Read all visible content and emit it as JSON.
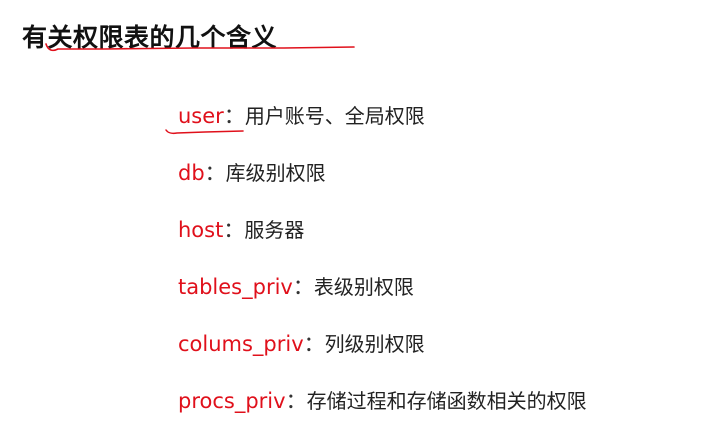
{
  "title": "有关权限表的几个含义",
  "separator": "：",
  "items": [
    {
      "key": "user",
      "desc": "用户账号、全局权限"
    },
    {
      "key": "db",
      "desc": "库级别权限"
    },
    {
      "key": "host",
      "desc": "服务器"
    },
    {
      "key": "tables_priv",
      "desc": "表级别权限"
    },
    {
      "key": "colums_priv",
      "desc": "列级别权限"
    },
    {
      "key": "procs_priv",
      "desc": "存储过程和存储函数相关的权限"
    }
  ],
  "colors": {
    "key_text": "#e0101b",
    "annotation": "#e0101b",
    "body_text": "#222222"
  }
}
